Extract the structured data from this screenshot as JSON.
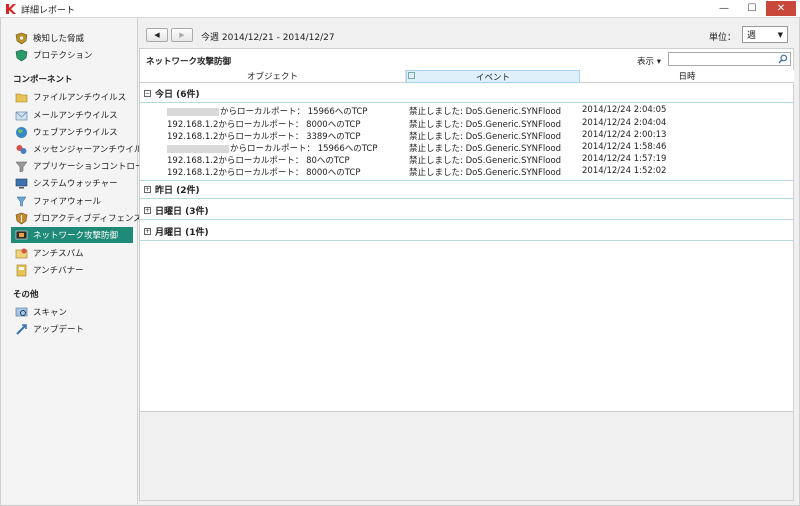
{
  "window": {
    "title": "詳細レポート",
    "minimize": "—",
    "maximize": "☐",
    "close": "✕"
  },
  "sidebar": {
    "top_items": [
      {
        "label": "検知した脅威",
        "icon": "shield-threat-icon"
      },
      {
        "label": "プロテクション",
        "icon": "shield-protection-icon"
      }
    ],
    "components_header": "コンポーネント",
    "components": [
      {
        "label": "ファイルアンチウイルス",
        "icon": "folder-icon"
      },
      {
        "label": "メールアンチウイルス",
        "icon": "mail-icon"
      },
      {
        "label": "ウェブアンチウイルス",
        "icon": "globe-icon"
      },
      {
        "label": "メッセンジャーアンチウイルス",
        "icon": "messenger-icon"
      },
      {
        "label": "アプリケーションコントロール",
        "icon": "filter-icon"
      },
      {
        "label": "システムウォッチャー",
        "icon": "monitor-icon"
      },
      {
        "label": "ファイアウォール",
        "icon": "firewall-icon"
      },
      {
        "label": "プロアクティブディフェンス",
        "icon": "shield-proactive-icon"
      },
      {
        "label": "ネットワーク攻撃防御",
        "icon": "network-attack-icon"
      },
      {
        "label": "アンチスパム",
        "icon": "antispam-icon"
      },
      {
        "label": "アンチバナー",
        "icon": "antibanner-icon"
      }
    ],
    "other_header": "その他",
    "other": [
      {
        "label": "スキャン",
        "icon": "scan-icon"
      },
      {
        "label": "アップデート",
        "icon": "update-icon"
      }
    ]
  },
  "toolbar": {
    "prev": "◀",
    "next": "▶",
    "period": "今週 2014/12/21 - 2014/12/27",
    "unit_label": "単位：",
    "unit_value": "週",
    "caret": "▼"
  },
  "panel": {
    "title": "ネットワーク攻撃防御",
    "view_label": "表示 ▾",
    "columns": {
      "object": "オブジェクト",
      "event": "イベント",
      "date": "日時"
    }
  },
  "groups": [
    {
      "label": "今日 (6件)",
      "expanded": "−"
    },
    {
      "label": "昨日 (2件)",
      "expanded": "+"
    },
    {
      "label": "日曜日 (3件)",
      "expanded": "+"
    },
    {
      "label": "月曜日 (1件)",
      "expanded": "+"
    }
  ],
  "rows": [
    {
      "object": "からローカルポート： 15966へのTCP",
      "event": "禁止しました: DoS.Generic.SYNFlood",
      "date": "2014/12/24 2:04:05"
    },
    {
      "object": "192.168.1.2からローカルポート： 8000へのTCP",
      "event": "禁止しました: DoS.Generic.SYNFlood",
      "date": "2014/12/24 2:04:04"
    },
    {
      "object": "192.168.1.2からローカルポート： 3389へのTCP",
      "event": "禁止しました: DoS.Generic.SYNFlood",
      "date": "2014/12/24 2:00:13"
    },
    {
      "object": "からローカルポート： 15966へのTCP",
      "event": "禁止しました: DoS.Generic.SYNFlood",
      "date": "2014/12/24 1:58:46"
    },
    {
      "object": "192.168.1.2からローカルポート： 80へのTCP",
      "event": "禁止しました: DoS.Generic.SYNFlood",
      "date": "2014/12/24 1:57:19"
    },
    {
      "object": "192.168.1.2からローカルポート： 8000へのTCP",
      "event": "禁止しました: DoS.Generic.SYNFlood",
      "date": "2014/12/24 1:52:02"
    }
  ],
  "colors": {
    "accent": "#1f8a78",
    "close": "#c9483c",
    "header_highlight": "#dff0fb",
    "group_line": "#b7dadc"
  }
}
